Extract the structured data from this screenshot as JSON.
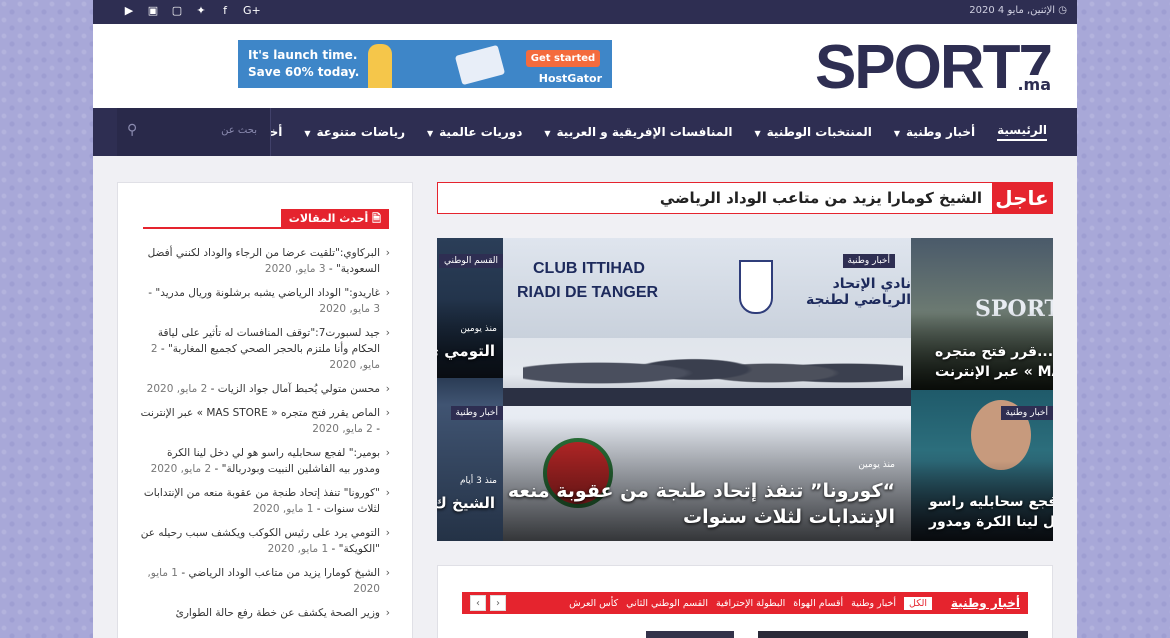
{
  "topbar": {
    "date": "الإثنين, مايو 4 2020",
    "social": [
      "youtube-play",
      "instagram",
      "youtube",
      "twitter",
      "facebook",
      "google-plus"
    ]
  },
  "header": {
    "logo_text": "SPORT7",
    "logo_suffix": ".ma",
    "ad": {
      "line1": "It's launch time.",
      "line2": "Save 60% today.",
      "cta": "Get started",
      "brand": "HostGator"
    }
  },
  "nav": {
    "items": [
      {
        "label": "الرئيسية",
        "caret": false
      },
      {
        "label": "أخبار وطنية",
        "caret": true
      },
      {
        "label": "المنتخبات الوطنية",
        "caret": true
      },
      {
        "label": "المنافسات الإفريقية و العربية",
        "caret": true
      },
      {
        "label": "دوريات عالمية",
        "caret": true
      },
      {
        "label": "رياضات متنوعة",
        "caret": true
      },
      {
        "label": "أخبار عامة",
        "caret": false
      }
    ],
    "search_placeholder": "بحث عن"
  },
  "breaking": {
    "tag": "عاجل",
    "headline": "الشيخ كومارا يزيد من متاعب الوداد الرياضي"
  },
  "slider": {
    "left": {
      "category": "القسم الوطني",
      "time": "منذ يومين",
      "title": "التومي ي... الكوكب"
    },
    "left_bottom": {
      "category": "أخبار وطنية",
      "time": "منذ 3 أيام",
      "title": "الشيخ ك... الوداد ال"
    },
    "main": {
      "banner_en1": "CLUB ITTIHAD",
      "banner_en2": "RIADI DE TANGER",
      "banner_ar": "نادي الإتحاد الرياضي لطنجة",
      "category": "أخبار وطنية",
      "time": "منذ يومين",
      "title_line1": "“كورونا” تنفذ إتحاد طنجة من عقوبة منعه من",
      "title_line2": "الإنتدابات لثلاث سنوات"
    },
    "right_top": {
      "watermark": "SPORT7",
      "title_line1": "...قرر فتح متجره",
      "title_line2": "MAS » عبر الإنترنت"
    },
    "right_bottom": {
      "category": "أخبار وطنية",
      "title_line1": "...فجع سحابليه راسو",
      "title_line2": "دخل لينا الكرة ومدور"
    }
  },
  "sidebar": {
    "title": "أحدث المقالات",
    "posts": [
      {
        "title": "البركاوي:\"تلقيت عرضا من الرجاء والوداد لكنني أفضل السعودية\"",
        "date": "3 مايو, 2020"
      },
      {
        "title": "غاريدو:\" الوداد الرياضي يشبه برشلونة وريال مدريد\"",
        "date": "3 مايو, 2020"
      },
      {
        "title": "جيد لسبورت7:\"توقف المنافسات له تأثير على لياقة الحكام وأنا ملتزم بالحجر الصحي كجميع المغاربة\"",
        "date": "2 مايو, 2020"
      },
      {
        "title": "محسن متولي يُحبط آمال جواد الزيات",
        "date": "2 مايو, 2020"
      },
      {
        "title": "الماص يقرر فتح متجره « MAS STORE » عبر الإنترنت",
        "date": "2 مايو, 2020"
      },
      {
        "title": "بومير:\" لفجع سحابليه راسو هو لي دخل لينا الكرة ومدور بيه الفاشلين النبيت وبودربالة\"",
        "date": "2 مايو, 2020"
      },
      {
        "title": "\"كورونا\" تنفذ إتحاد طنجة من عقوبة منعه من الإنتدابات لثلاث سنوات",
        "date": "1 مايو, 2020"
      },
      {
        "title": "التومي يرد على رئيس الكوكب ويكشف سبب رحيله عن \"الكويكة\"",
        "date": "1 مايو, 2020"
      },
      {
        "title": "الشيخ كومارا يزيد من متاعب الوداد الرياضي",
        "date": "1 مايو, 2020"
      },
      {
        "title": "وزير الصحة يكشف عن خطة رفع حالة الطوارئ",
        "date": ""
      }
    ]
  },
  "news_block": {
    "title": "أخبار وطنية",
    "tabs": [
      "الكل",
      "أخبار وطنية",
      "أقسام الهواة",
      "البطولة الإحترافية",
      "القسم الوطني الثاني",
      "كأس العرش"
    ],
    "active_tab": "الكل"
  },
  "colors": {
    "primary": "#2e2e52",
    "accent": "#e5242e"
  }
}
